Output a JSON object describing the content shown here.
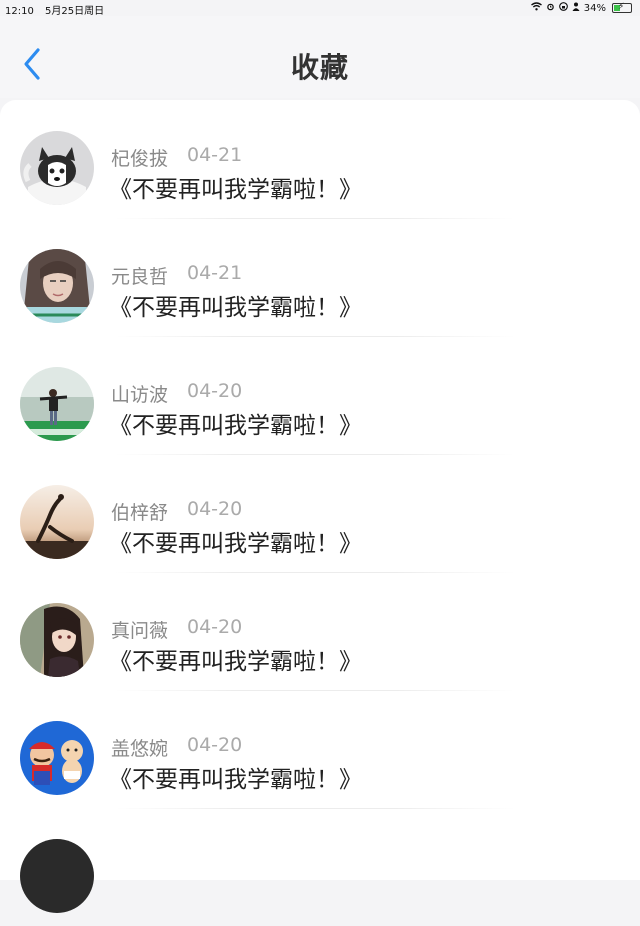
{
  "status_bar": {
    "time": "12:10",
    "date": "5月25日周日",
    "battery": "34%"
  },
  "header": {
    "title": "收藏",
    "back_icon": "chevron-left-icon",
    "accent_color": "#2d8cf0"
  },
  "items": [
    {
      "name": "杞俊拔",
      "date": "04-21",
      "title": "《不要再叫我学霸啦！》",
      "avatar": "husky-dog"
    },
    {
      "name": "元良哲",
      "date": "04-21",
      "title": "《不要再叫我学霸啦！》",
      "avatar": "woman-portrait"
    },
    {
      "name": "山访波",
      "date": "04-20",
      "title": "《不要再叫我学霸啦！》",
      "avatar": "man-outdoors"
    },
    {
      "name": "伯梓舒",
      "date": "04-20",
      "title": "《不要再叫我学霸啦！》",
      "avatar": "yoga-sunset"
    },
    {
      "name": "真问薇",
      "date": "04-20",
      "title": "《不要再叫我学霸啦！》",
      "avatar": "anime-girl"
    },
    {
      "name": "盖悠婉",
      "date": "04-20",
      "title": "《不要再叫我学霸啦！》",
      "avatar": "cartoon-characters"
    }
  ]
}
